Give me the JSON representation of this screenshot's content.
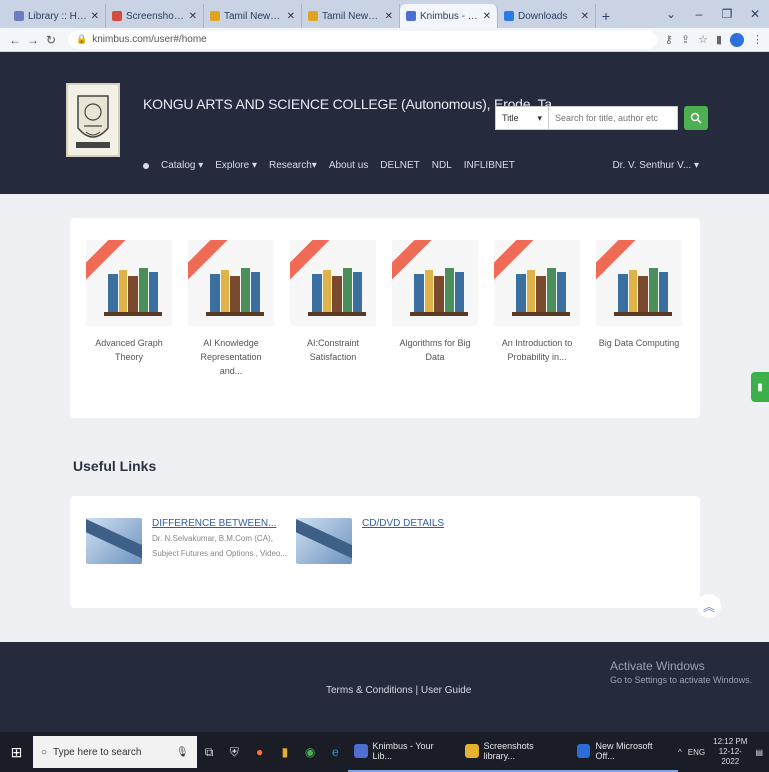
{
  "browser": {
    "tabs": [
      {
        "label": "Library :: Home Page",
        "color": "#6b7fc2"
      },
      {
        "label": "Screenshots - mg",
        "color": "#d44c3c"
      },
      {
        "label": "Tamil News Latest To",
        "color": "#e0a31f"
      },
      {
        "label": "Tamil News | Online",
        "color": "#e0a31f"
      },
      {
        "label": "Knimbus - Your Libr",
        "color": "#4d6fd1",
        "active": true
      },
      {
        "label": "Downloads",
        "color": "#2c7be5"
      }
    ],
    "url": "knimbus.com/user#/home"
  },
  "header": {
    "college_name": "KONGU ARTS AND SCIENCE COLLEGE (Autonomous), Erode, Ta...",
    "search_scope": "Title",
    "search_placeholder": "Search for title, author etc",
    "menu": [
      "Catalog ▾",
      "Explore ▾",
      "Research▾",
      "About us",
      "DELNET",
      "NDL",
      "INFLIBNET"
    ],
    "user": "Dr. V. Senthur V... ▾"
  },
  "books": [
    {
      "title": "Advanced Graph Theory"
    },
    {
      "title": "AI Knowledge Representation and..."
    },
    {
      "title": "AI:Constraint Satisfaction"
    },
    {
      "title": "Algorithms for Big Data"
    },
    {
      "title": "An Introduction to Probability in..."
    },
    {
      "title": "Big Data Computing"
    }
  ],
  "useful_links": {
    "heading": "Useful Links",
    "items": [
      {
        "title": "DIFFERENCE BETWEEN...",
        "meta1": "Dr. N.Selvakumar, B.M.Com (CA),",
        "meta2": "Subject Futures and Options , Video..."
      },
      {
        "title": "CD/DVD DETAILS",
        "meta1": "",
        "meta2": ""
      }
    ]
  },
  "footer": {
    "links": "Terms & Conditions | User Guide",
    "activate_title": "Activate Windows",
    "activate_sub": "Go to Settings to activate Windows."
  },
  "taskbar": {
    "search_placeholder": "Type here to search",
    "apps": [
      {
        "label": "Knimbus - Your Lib...",
        "color": "#4d6fd1"
      },
      {
        "label": "Screenshots library...",
        "color": "#e5b12e"
      },
      {
        "label": "New Microsoft Off...",
        "color": "#2b6cd6"
      }
    ],
    "lang": "ENG",
    "time": "12:12 PM",
    "date": "12-12-2022"
  }
}
